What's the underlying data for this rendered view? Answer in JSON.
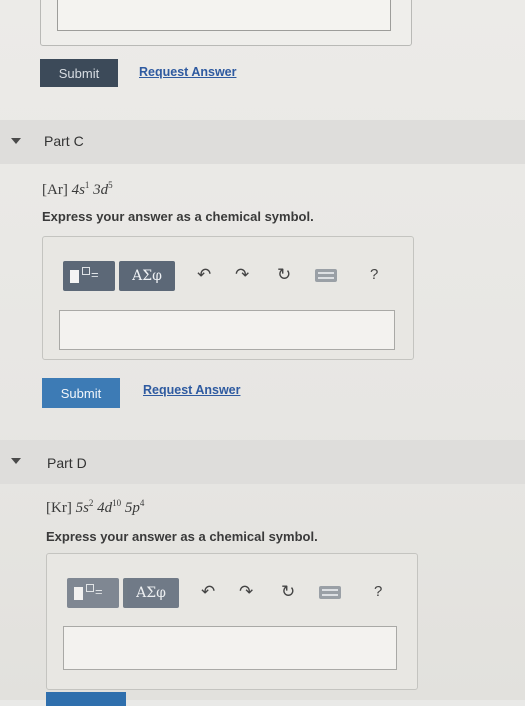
{
  "top": {
    "submit_label": "Submit",
    "request_label": "Request Answer"
  },
  "partC": {
    "header": "Part C",
    "formula_core": "[Ar]",
    "formula_parts": [
      {
        "orb": "4s",
        "exp": "1"
      },
      {
        "orb": "3d",
        "exp": "5"
      }
    ],
    "instruction": "Express your answer as a chemical symbol.",
    "greek_label": "ΑΣφ",
    "help_label": "?",
    "submit_label": "Submit",
    "request_label": "Request Answer"
  },
  "partD": {
    "header": "Part D",
    "formula_core": "[Kr]",
    "formula_parts": [
      {
        "orb": "5s",
        "exp": "2"
      },
      {
        "orb": "4d",
        "exp": "10"
      },
      {
        "orb": "5p",
        "exp": "4"
      }
    ],
    "instruction": "Express your answer as a chemical symbol.",
    "greek_label": "ΑΣφ",
    "help_label": "?"
  },
  "icons": {
    "undo": "undo-icon",
    "redo": "redo-icon",
    "reset": "reset-icon",
    "keyboard": "keyboard-icon",
    "help": "help-icon",
    "collapse": "chevron-down-icon",
    "template": "template-icon"
  },
  "colors": {
    "submit_dark": "#3c4a59",
    "submit_blue": "#3d7bb5",
    "link": "#2e5aa0",
    "toolbar_btn": "#5c6877"
  }
}
